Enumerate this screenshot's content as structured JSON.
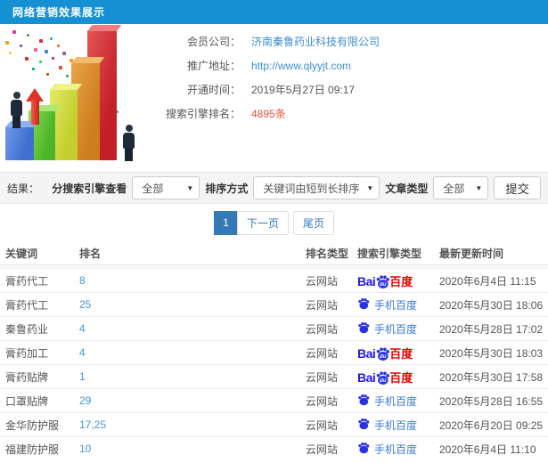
{
  "header": {
    "title": "网络营销效果展示"
  },
  "info": {
    "rows": [
      {
        "label": "会员公司：",
        "value": "济南秦鲁药业科技有限公司",
        "style": "link"
      },
      {
        "label": "推广地址：",
        "value": "http://www.qlyyjt.com",
        "style": "link"
      },
      {
        "label": "开通时间：",
        "value": "2019年5月27日 09:17",
        "style": "text"
      },
      {
        "label": "搜索引擎排名：",
        "value": "4895条",
        "style": "red"
      }
    ]
  },
  "filters": {
    "result_label": "结果：",
    "engine_label": "分搜索引擎查看",
    "engine_value": "全部",
    "sort_label": "排序方式",
    "sort_value": "关键词由短到长排序",
    "article_label": "文章类型",
    "article_value": "全部",
    "submit_label": "提交",
    "caret": "▼"
  },
  "pagination": {
    "current": "1",
    "next_label": "下一页",
    "last_label": "尾页"
  },
  "table": {
    "headers": [
      "关键词",
      "排名",
      "排名类型",
      "搜索引擎类型",
      "最新更新时间"
    ],
    "engine_logo": {
      "bai": "Bai",
      "du": "du",
      "cn": "百度",
      "mobile": "手机百度"
    },
    "rows": [
      {
        "keyword": "膏药代工",
        "rank": "8",
        "rank_type": "云网站",
        "engine": "baidu_pc",
        "updated": "2020年6月4日 11:15"
      },
      {
        "keyword": "膏药代工",
        "rank": "25",
        "rank_type": "云网站",
        "engine": "baidu_mobile",
        "updated": "2020年5月30日 18:06"
      },
      {
        "keyword": "秦鲁药业",
        "rank": "4",
        "rank_type": "云网站",
        "engine": "baidu_mobile",
        "updated": "2020年5月28日 17:02"
      },
      {
        "keyword": "膏药加工",
        "rank": "4",
        "rank_type": "云网站",
        "engine": "baidu_pc",
        "updated": "2020年5月30日 18:03"
      },
      {
        "keyword": "膏药贴牌",
        "rank": "1",
        "rank_type": "云网站",
        "engine": "baidu_pc",
        "updated": "2020年5月30日 17:58"
      },
      {
        "keyword": "口罩贴牌",
        "rank": "29",
        "rank_type": "云网站",
        "engine": "baidu_mobile",
        "updated": "2020年5月28日 16:55"
      },
      {
        "keyword": "金华防护服",
        "rank": "17,25",
        "rank_type": "云网站",
        "engine": "baidu_mobile",
        "updated": "2020年6月20日 09:25"
      },
      {
        "keyword": "福建防护服",
        "rank": "10",
        "rank_type": "云网站",
        "engine": "baidu_mobile",
        "updated": "2020年6月4日 11:10"
      }
    ]
  },
  "colors": {
    "header_bg": "#1590d2",
    "link_blue": "#3e8ed0",
    "rank_blue": "#4596d6",
    "highlight_red": "#f0503c",
    "pager_active": "#337ab7",
    "baidu_blue": "#2932e1",
    "baidu_red": "#e10602"
  }
}
